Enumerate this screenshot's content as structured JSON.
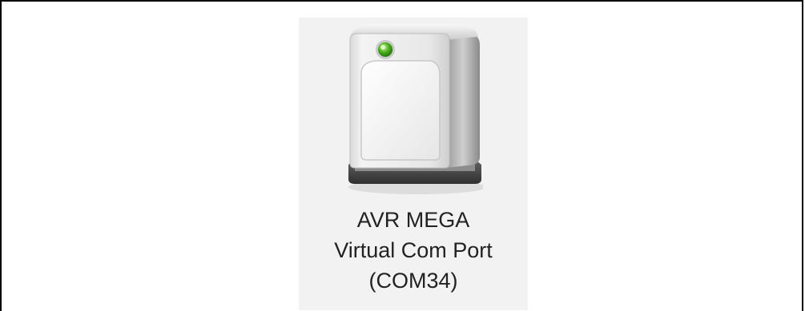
{
  "device": {
    "icon": "usb-serial-device-icon",
    "status_led_color": "#4caf1f",
    "label_lines": [
      "AVR MEGA",
      "Virtual Com Port",
      "(COM34)"
    ]
  }
}
